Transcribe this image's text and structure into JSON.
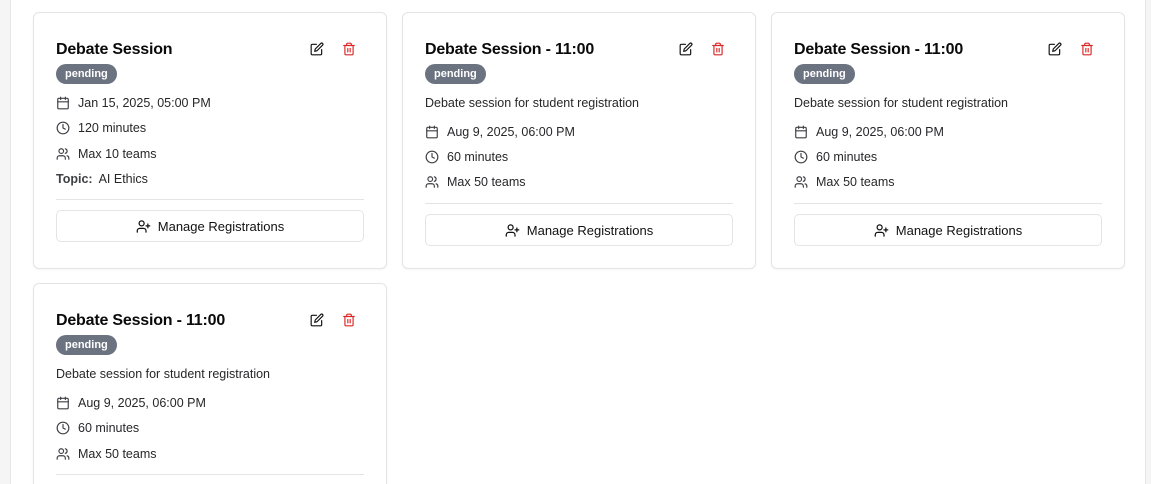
{
  "cards": [
    {
      "title": "Debate Session",
      "status": "pending",
      "description": "",
      "date": "Jan 15, 2025, 05:00 PM",
      "duration": "120 minutes",
      "teams": "Max 10 teams",
      "topic_label": "Topic:",
      "topic": "AI Ethics",
      "manage_label": "Manage Registrations"
    },
    {
      "title": "Debate Session - 11:00",
      "status": "pending",
      "description": "Debate session for student registration",
      "date": "Aug 9, 2025, 06:00 PM",
      "duration": "60 minutes",
      "teams": "Max 50 teams",
      "manage_label": "Manage Registrations"
    },
    {
      "title": "Debate Session - 11:00",
      "status": "pending",
      "description": "Debate session for student registration",
      "date": "Aug 9, 2025, 06:00 PM",
      "duration": "60 minutes",
      "teams": "Max 50 teams",
      "manage_label": "Manage Registrations"
    },
    {
      "title": "Debate Session - 11:00",
      "status": "pending",
      "description": "Debate session for student registration",
      "date": "Aug 9, 2025, 06:00 PM",
      "duration": "60 minutes",
      "teams": "Max 50 teams"
    }
  ],
  "colors": {
    "badge_bg": "#6b7280",
    "delete_icon": "#dc2626",
    "edit_icon": "#111111"
  },
  "icons": {
    "edit": "pencil-square-icon",
    "delete": "trash-icon",
    "date": "calendar-icon",
    "duration": "clock-icon",
    "teams": "users-icon",
    "manage": "user-plus-icon"
  }
}
